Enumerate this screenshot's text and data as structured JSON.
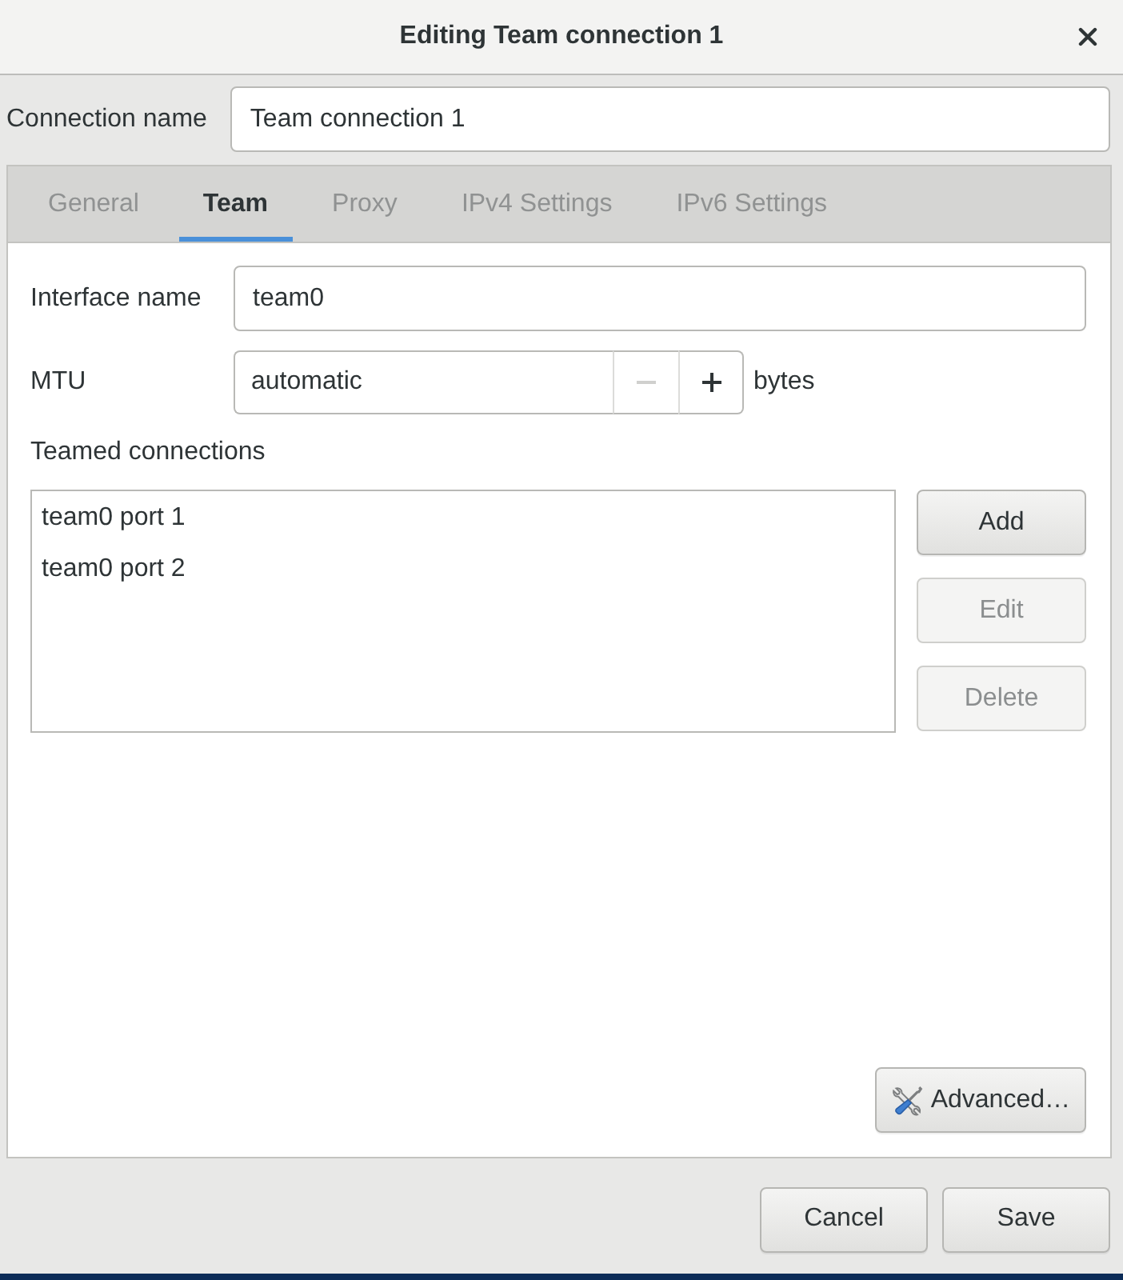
{
  "window": {
    "title": "Editing Team connection 1"
  },
  "connection_name": {
    "label": "Connection name",
    "value": "Team connection 1"
  },
  "tabs": [
    {
      "label": "General",
      "selected": false
    },
    {
      "label": "Team",
      "selected": true
    },
    {
      "label": "Proxy",
      "selected": false
    },
    {
      "label": "IPv4 Settings",
      "selected": false
    },
    {
      "label": "IPv6 Settings",
      "selected": false
    }
  ],
  "team_page": {
    "interface_name": {
      "label": "Interface name",
      "value": "team0"
    },
    "mtu": {
      "label": "MTU",
      "value": "automatic",
      "stepper": [
        {
          "kind": "decrement",
          "disabled": true
        },
        {
          "kind": "increment",
          "disabled": false
        }
      ],
      "unit": "bytes"
    },
    "teamed_connections": {
      "label": "Teamed connections",
      "items": [
        {
          "label": "team0 port 1",
          "selected": false
        },
        {
          "label": "team0 port 2",
          "selected": false
        }
      ]
    },
    "list_buttons": [
      {
        "label": "Add",
        "disabled": false
      },
      {
        "label": "Edit",
        "disabled": true
      },
      {
        "label": "Delete",
        "disabled": true
      }
    ],
    "advanced_button": {
      "label": "Advanced…"
    }
  },
  "buttons": [
    {
      "label": "Cancel"
    },
    {
      "label": "Save"
    }
  ]
}
